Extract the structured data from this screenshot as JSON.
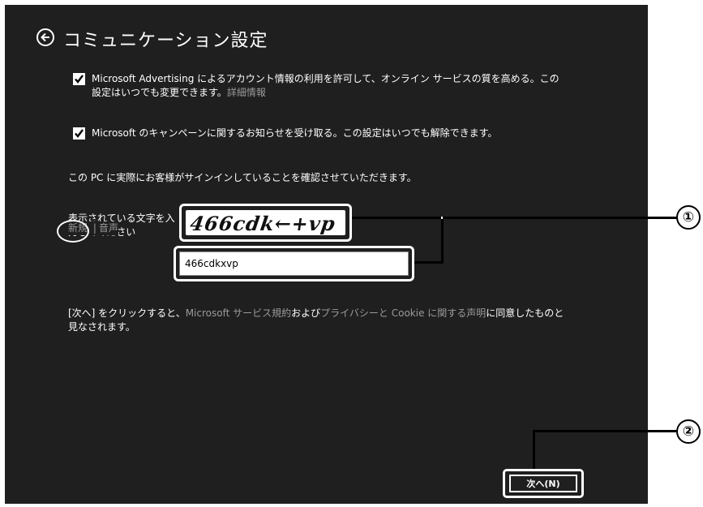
{
  "header": {
    "title": "コミュニケーション設定",
    "back_icon": "back-arrow-icon"
  },
  "options": {
    "advertising": {
      "checked": true,
      "line1": "Microsoft Advertising によるアカウント情報の利用を許可して、オンライン サービスの質を高める。この",
      "line2": "設定はいつでも変更できます。",
      "link": "詳細情報"
    },
    "campaign": {
      "checked": true,
      "text": "Microsoft のキャンペーンに関するお知らせを受け取る。この設定はいつでも解除できます。"
    }
  },
  "verify": {
    "notice": "この PC に実際にお客様がサインインしていることを確認させていただきます。",
    "prompt_line1": "表示されている文字を入",
    "prompt_line2": "力してください",
    "new_link": "新規",
    "separator": "|",
    "audio_link": "音声",
    "captcha_text": "466cdk←+vp",
    "input_value": "466cdkxvp"
  },
  "terms": {
    "part1": "[次へ] をクリックすると、",
    "link1": "Microsoft サービス規約",
    "part2": "および",
    "link2": "プライバシーと Cookie に関する声明",
    "part3": "に同意したものと",
    "line2": "見なされます。"
  },
  "footer": {
    "next_label": "次へ(N)"
  },
  "callouts": {
    "one": "①",
    "two": "②"
  },
  "colors": {
    "background": "#1f1f1f",
    "text": "#ffffff",
    "link": "#9a9a9a"
  }
}
